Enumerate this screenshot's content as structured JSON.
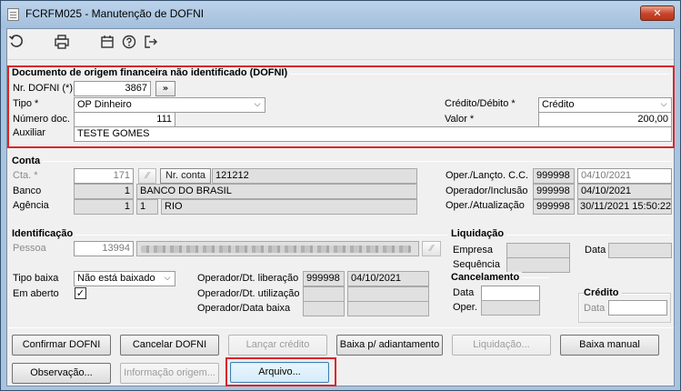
{
  "window": {
    "title": "FCRFM025 - Manutenção de DOFNI",
    "close_glyph": "✕"
  },
  "toolbar": {
    "icons": [
      "undo-icon",
      "print-icon",
      "calendar-icon",
      "help-icon",
      "exit-icon"
    ]
  },
  "dofni": {
    "section_title": "Documento de origem financeira não identificado (DOFNI)",
    "nr_label": "Nr. DOFNI (*)",
    "nr_value": "3867",
    "nr_button": "»",
    "tipo_label": "Tipo *",
    "tipo_value": "OP Dinheiro",
    "numero_doc_label": "Número doc.",
    "numero_doc_value": "111",
    "auxiliar_label": "Auxiliar",
    "auxiliar_value": "TESTE GOMES",
    "credito_debito_label": "Crédito/Débito *",
    "credito_debito_value": "Crédito",
    "valor_label": "Valor *",
    "valor_value": "200,00"
  },
  "conta": {
    "section_title": "Conta",
    "cta_label": "Cta. *",
    "cta_value": "171",
    "nr_conta_button": "Nr. conta",
    "nr_conta_value": "121212",
    "banco_label": "Banco",
    "banco_code": "1",
    "banco_name": "BANCO DO BRASIL",
    "agencia_label": "Agência",
    "agencia_code": "1",
    "agencia_digit": "1",
    "agencia_name": "RIO",
    "oper_lancto_label": "Oper./Lançto. C.C.",
    "oper_lancto_op": "999998",
    "oper_lancto_date": "04/10/2021",
    "oper_inclusao_label": "Operador/Inclusão",
    "oper_inclusao_op": "999998",
    "oper_inclusao_date": "04/10/2021",
    "oper_atualizacao_label": "Oper./Atualização",
    "oper_atualizacao_op": "999998",
    "oper_atualizacao_date": "30/11/2021 15:50:22"
  },
  "identificacao": {
    "section_title": "Identificação",
    "pessoa_label": "Pessoa",
    "pessoa_value": "13994",
    "tipo_baixa_label": "Tipo baixa",
    "tipo_baixa_value": "Não está baixado",
    "em_aberto_label": "Em aberto",
    "em_aberto_checked": true,
    "em_aberto_glyph": "✓",
    "dt_liberacao_label": "Operador/Dt. liberação",
    "dt_liberacao_op": "999998",
    "dt_liberacao_date": "04/10/2021",
    "dt_utilizacao_label": "Operador/Dt. utilização",
    "data_baixa_label": "Operador/Data baixa"
  },
  "liquidacao": {
    "section_title": "Liquidação",
    "empresa_label": "Empresa",
    "sequencia_label": "Sequência",
    "data_label": "Data"
  },
  "cancelamento": {
    "section_title": "Cancelamento",
    "data_label": "Data",
    "oper_label": "Oper."
  },
  "credito": {
    "section_title": "Crédito",
    "data_label": "Data"
  },
  "buttons": {
    "confirmar": "Confirmar DOFNI",
    "cancelar": "Cancelar DOFNI",
    "lancar_credito": "Lançar crédito",
    "baixa_adiantamento": "Baixa p/ adiantamento",
    "liquidacao": "Liquidação...",
    "baixa_manual": "Baixa manual",
    "observacao": "Observação...",
    "informacao_origem": "Informação origem...",
    "arquivo": "Arquivo..."
  },
  "colors": {
    "highlight": "#d9262b",
    "window_frame": "#a9c4de",
    "client_bg": "#f0f0f0",
    "readonly_field": "#e0e0e0"
  }
}
